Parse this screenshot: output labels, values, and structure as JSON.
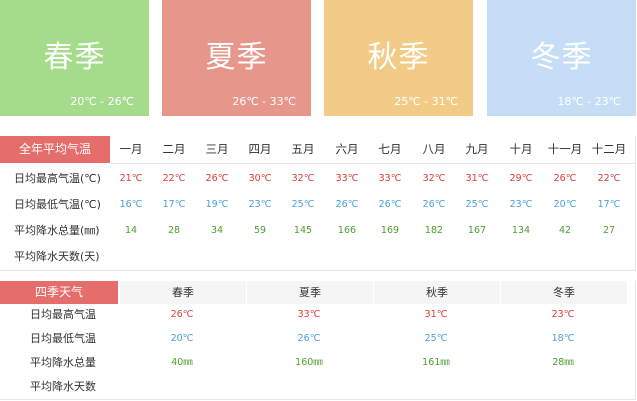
{
  "season_cards": [
    {
      "name": "春季",
      "range": "20℃ - 26℃",
      "color": "#a5dc8c"
    },
    {
      "name": "夏季",
      "range": "26℃ - 33℃",
      "color": "#e6968a"
    },
    {
      "name": "秋季",
      "range": "25℃ - 31℃",
      "color": "#f2cc86"
    },
    {
      "name": "冬季",
      "range": "18℃ - 23℃",
      "color": "#c5def5"
    }
  ],
  "annual": {
    "title": "全年平均气温",
    "months": [
      "一月",
      "二月",
      "三月",
      "四月",
      "五月",
      "六月",
      "七月",
      "八月",
      "九月",
      "十月",
      "十一月",
      "十二月"
    ],
    "rows": [
      {
        "label": "日均最高气温(℃)",
        "kind": "hi",
        "values": [
          "21℃",
          "22℃",
          "26℃",
          "30℃",
          "32℃",
          "33℃",
          "33℃",
          "32℃",
          "31℃",
          "29℃",
          "26℃",
          "22℃"
        ]
      },
      {
        "label": "日均最低气温(℃)",
        "kind": "lo",
        "values": [
          "16℃",
          "17℃",
          "19℃",
          "23℃",
          "25℃",
          "26℃",
          "26℃",
          "26℃",
          "25℃",
          "23℃",
          "20℃",
          "17℃"
        ]
      },
      {
        "label": "平均降水总量(㎜)",
        "kind": "rain",
        "values": [
          "14",
          "28",
          "34",
          "59",
          "145",
          "166",
          "169",
          "182",
          "167",
          "134",
          "42",
          "27"
        ]
      },
      {
        "label": "平均降水天数(天)",
        "kind": "rain",
        "values": [
          "",
          "",
          "",
          "",
          "",
          "",
          "",
          "",
          "",
          "",
          "",
          ""
        ]
      }
    ]
  },
  "seasons_table": {
    "title": "四季天气",
    "columns": [
      "春季",
      "夏季",
      "秋季",
      "冬季"
    ],
    "rows": [
      {
        "label": "日均最高气温",
        "kind": "hi",
        "values": [
          "26℃",
          "33℃",
          "31℃",
          "23℃"
        ]
      },
      {
        "label": "日均最低气温",
        "kind": "lo",
        "values": [
          "20℃",
          "26℃",
          "25℃",
          "18℃"
        ]
      },
      {
        "label": "平均降水总量",
        "kind": "rain",
        "values": [
          "40㎜",
          "160㎜",
          "161㎜",
          "28㎜"
        ]
      },
      {
        "label": "平均降水天数",
        "kind": "rain",
        "values": [
          "",
          "",
          "",
          ""
        ]
      }
    ]
  }
}
